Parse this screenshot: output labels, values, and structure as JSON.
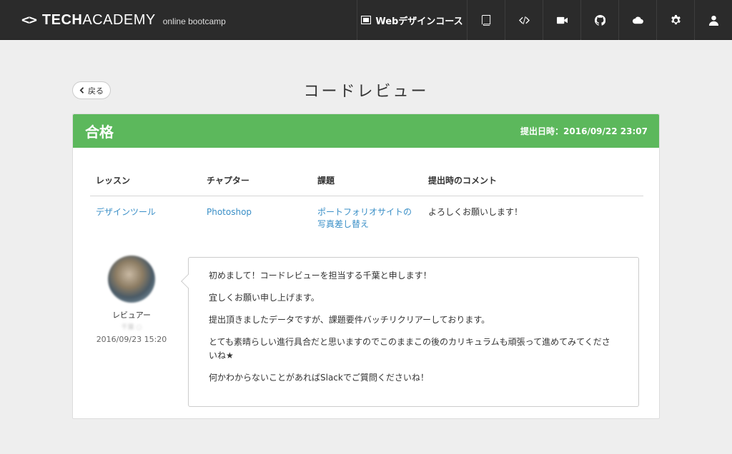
{
  "header": {
    "logo": {
      "mark": "<>",
      "tech": "TECH",
      "academy": "ACADEMY",
      "sub": "online bootcamp"
    },
    "course_label": "Webデザインコース",
    "nav_icons": [
      "book-icon",
      "code-icon",
      "video-camera-icon",
      "github-icon",
      "cloud-icon",
      "gear-icon",
      "user-icon"
    ]
  },
  "page": {
    "back_label": "戻る",
    "title": "コードレビュー"
  },
  "review": {
    "status": "合格",
    "submitted_at": "提出日時：2016/09/22 23:07",
    "accent_color": "#5cb85c",
    "link_color": "#3a8fc7",
    "columns": [
      "レッスン",
      "チャプター",
      "課題",
      "提出時のコメント"
    ],
    "row": {
      "lesson": "デザインツール",
      "chapter": "Photoshop",
      "task_line1": "ポートフォリオサイトの",
      "task_line2": "写真差し替え",
      "comment": "よろしくお願いします！"
    },
    "reviewer": {
      "role": "レビュアー",
      "name": "千葉 ○",
      "date": "2016/09/23 15:20"
    },
    "message": [
      "初めまして！コードレビューを担当する千葉と申します！",
      "宜しくお願い申し上げます。",
      "提出頂きましたデータですが、課題要件バッチリクリアーしております。",
      "とても素晴らしい進行具合だと思いますのでこのままこの後のカリキュラムも頑張って進めてみてくださいね★",
      "何かわからないことがあればSlackでご質問くださいね！"
    ]
  }
}
